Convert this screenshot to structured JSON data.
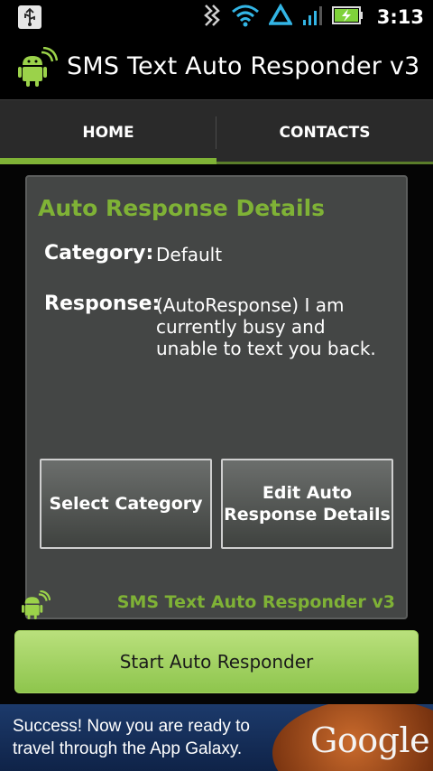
{
  "status_bar": {
    "time": "3:13",
    "icons": [
      "usb-icon",
      "sync-icon",
      "wifi-icon",
      "data-arrow-icon",
      "signal-icon",
      "battery-charging-icon"
    ],
    "accent": "#33b5e5"
  },
  "app": {
    "title": "SMS Text Auto Responder v3",
    "logo_icon": "android-robot-icon"
  },
  "tabs": [
    {
      "label": "HOME",
      "selected": true
    },
    {
      "label": "CONTACTS",
      "selected": false
    }
  ],
  "panel": {
    "title": "Auto Response Details",
    "category_label": "Category:",
    "category_value": "Default",
    "response_label": "Response:",
    "response_value": "(AutoResponse) I am currently busy and unable to text you back.",
    "select_category_label": "Select Category",
    "edit_details_label": "Edit Auto Response Details",
    "footer": "SMS Text Auto Responder v3"
  },
  "start_button": {
    "label": "Start Auto Responder"
  },
  "ad": {
    "text_line1": "Success! Now you are ready to",
    "text_line2": "travel through the App Galaxy.",
    "brand": "Google"
  },
  "colors": {
    "accent_green": "#7fb236",
    "panel_bg": "#444645",
    "start_button": "#a4d35f"
  }
}
